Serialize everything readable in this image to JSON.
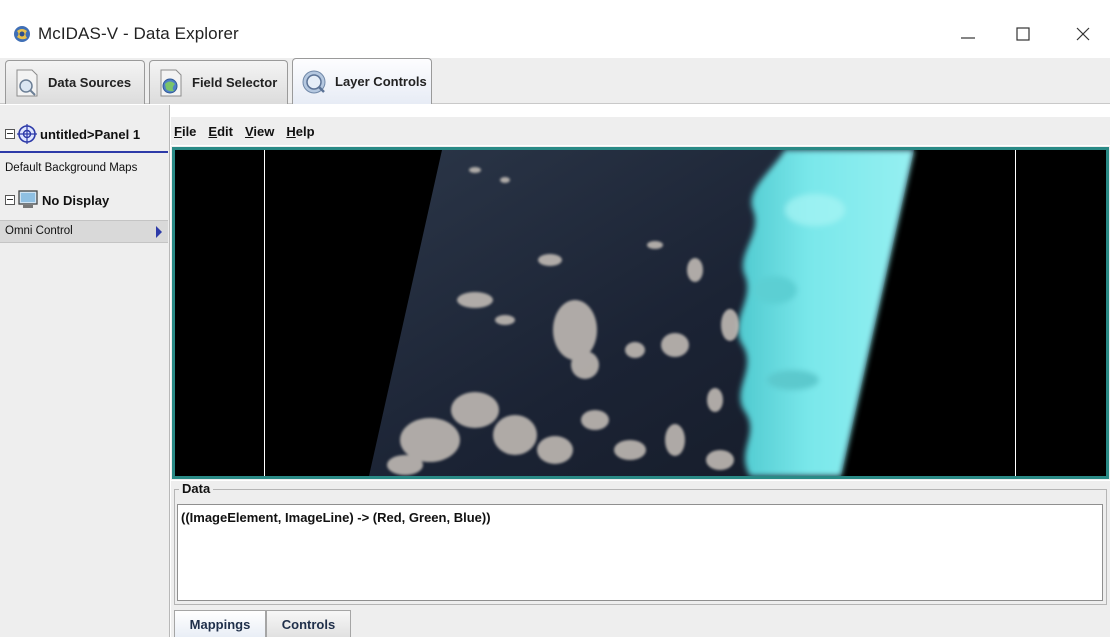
{
  "window": {
    "title": "McIDAS-V - Data Explorer",
    "controls": {
      "minimize": "—",
      "maximize": "☐",
      "close": "✕"
    }
  },
  "tabs": [
    {
      "label": "Data Sources",
      "icon": "data-sources-icon"
    },
    {
      "label": "Field Selector",
      "icon": "field-selector-icon"
    },
    {
      "label": "Layer Controls",
      "icon": "layer-controls-icon",
      "active": true
    }
  ],
  "left_panel": {
    "panel_node": {
      "label": "untitled>Panel 1",
      "icon": "crosshair-globe-icon"
    },
    "maps_item": "Default Background Maps",
    "display_node": {
      "label": "No Display",
      "icon": "monitor-icon"
    },
    "omni_item": "Omni Control"
  },
  "menubar": [
    {
      "mnemonic": "F",
      "rest": "ile"
    },
    {
      "mnemonic": "E",
      "rest": "dit"
    },
    {
      "mnemonic": "V",
      "rest": "iew"
    },
    {
      "mnemonic": "H",
      "rest": "elp"
    }
  ],
  "data_section": {
    "title": "Data",
    "content": "((ImageElement, ImageLine) -> (Red, Green, Blue))"
  },
  "bottom_tabs": [
    {
      "label": "Mappings",
      "active": true
    },
    {
      "label": "Controls"
    }
  ],
  "colors": {
    "frame_border": "#2a8a86",
    "panel_underline": "#2d3aa8",
    "cloud_cyan": "#6fe3e6",
    "ocean": "#1c2436"
  }
}
